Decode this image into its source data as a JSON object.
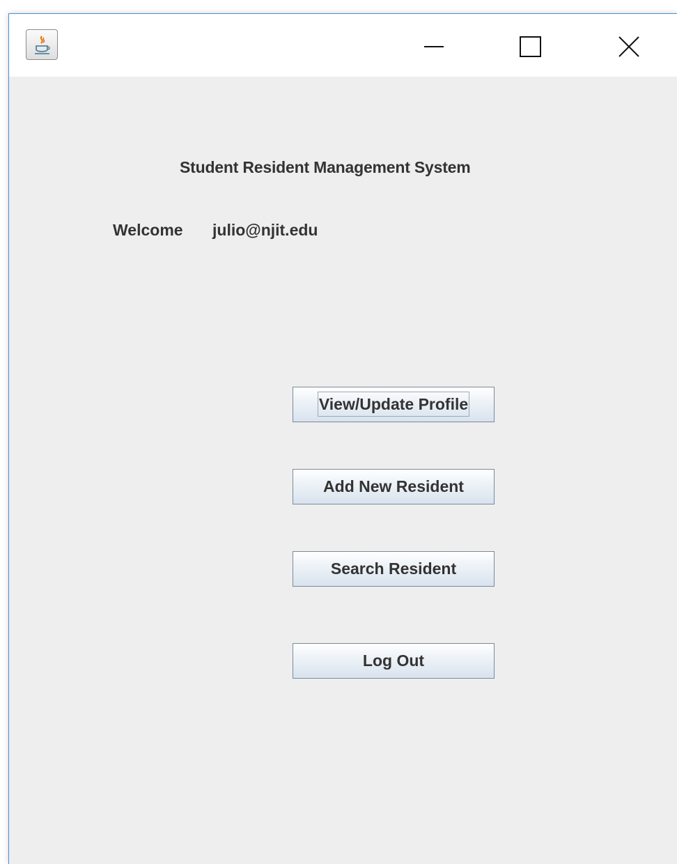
{
  "window": {
    "app_icon": "java-icon",
    "controls": {
      "minimize_icon": "minimize-icon",
      "maximize_icon": "maximize-icon",
      "close_icon": "close-icon"
    }
  },
  "main": {
    "title": "Student Resident Management System",
    "welcome_label": "Welcome",
    "user_email": "julio@njit.edu",
    "buttons": [
      {
        "label": "View/Update Profile",
        "focused": true
      },
      {
        "label": "Add New Resident",
        "focused": false
      },
      {
        "label": "Search Resident",
        "focused": false
      },
      {
        "label": "Log Out",
        "focused": false
      }
    ]
  }
}
